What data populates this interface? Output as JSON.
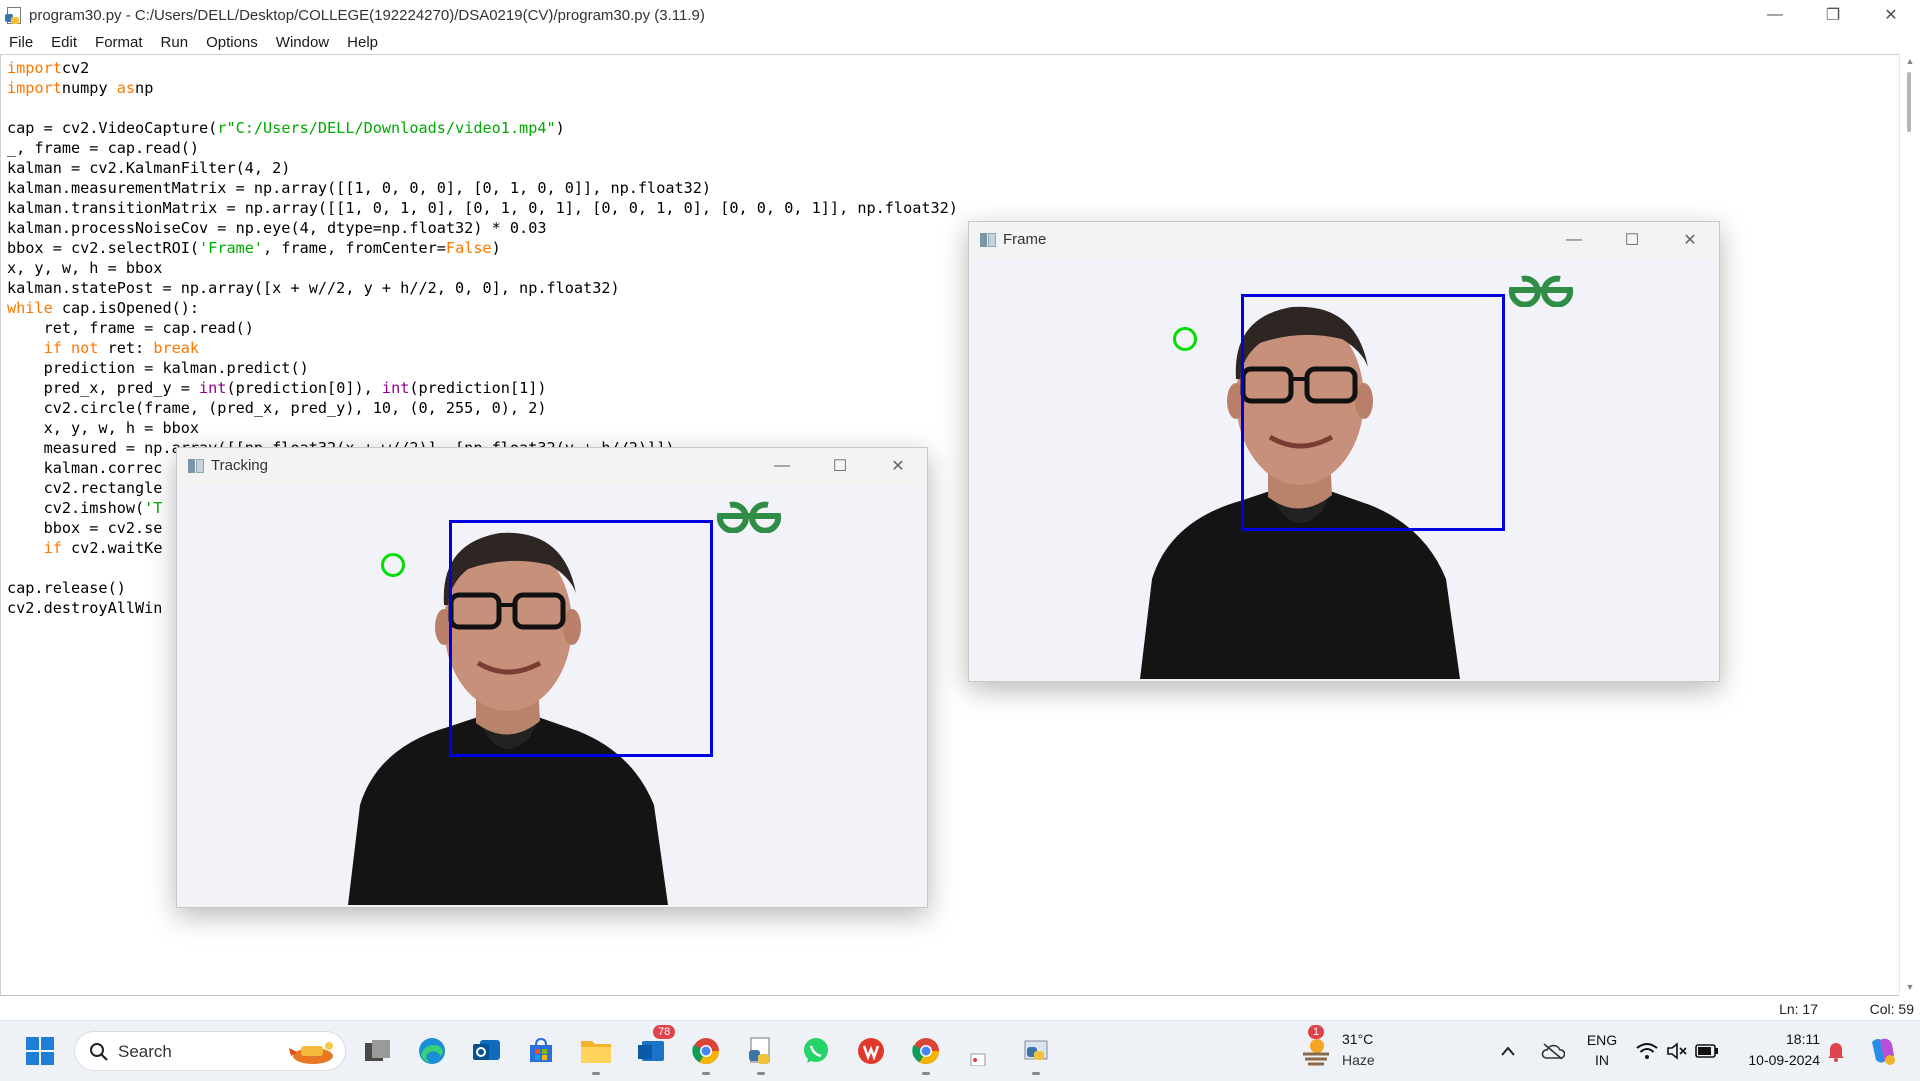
{
  "window": {
    "title": "program30.py - C:/Users/DELL/Desktop/COLLEGE(192224270)/DSA0219(CV)/program30.py (3.11.9)",
    "minimize_glyph": "—",
    "restore_glyph": "❐",
    "close_glyph": "✕"
  },
  "menu": [
    "File",
    "Edit",
    "Format",
    "Run",
    "Options",
    "Window",
    "Help"
  ],
  "code_lines": [
    [
      [
        "kw",
        "import"
      ],
      [
        "",
        "cv2"
      ]
    ],
    [
      [
        "kw",
        "import"
      ],
      [
        "",
        "numpy "
      ],
      [
        "kw",
        "as"
      ],
      [
        "",
        "np"
      ]
    ],
    [],
    [
      [
        "",
        "cap = cv2.VideoCapture("
      ],
      [
        "st",
        "r\"C:/Users/DELL/Downloads/video1.mp4\""
      ],
      [
        "",
        ")"
      ]
    ],
    [
      [
        "",
        "_, frame = cap.read()"
      ]
    ],
    [
      [
        "",
        "kalman = cv2.KalmanFilter(4, 2)"
      ]
    ],
    [
      [
        "",
        "kalman.measurementMatrix = np.array([[1, 0, 0, 0], [0, 1, 0, 0]], np.float32)"
      ]
    ],
    [
      [
        "",
        "kalman.transitionMatrix = np.array([[1, 0, 1, 0], [0, 1, 0, 1], [0, 0, 1, 0], [0, 0, 0, 1]], np.float32)"
      ]
    ],
    [
      [
        "",
        "kalman.processNoiseCov = np.eye(4, dtype=np.float32) * 0.03"
      ]
    ],
    [
      [
        "",
        "bbox = cv2.selectROI("
      ],
      [
        "st",
        "'Frame'"
      ],
      [
        "",
        ", frame, fromCenter="
      ],
      [
        "kw",
        "False"
      ],
      [
        "",
        ")"
      ]
    ],
    [
      [
        "",
        "x, y, w, h = bbox"
      ]
    ],
    [
      [
        "",
        "kalman.statePost = np.array([x + w//2, y + h//2, 0, 0], np.float32)"
      ]
    ],
    [
      [
        "kw",
        "while"
      ],
      [
        "",
        "",
        " "
      ],
      [
        "",
        "cap.isOpened():"
      ]
    ],
    [
      [
        "",
        "    ret, frame = cap.read()"
      ]
    ],
    [
      [
        "",
        "    "
      ],
      [
        "kw",
        "if not"
      ],
      [
        "",
        "",
        " "
      ],
      [
        "",
        "ret: "
      ],
      [
        "kw",
        "break"
      ]
    ],
    [
      [
        "",
        "    prediction = kalman.predict()"
      ]
    ],
    [
      [
        "",
        "    pred_x, pred_y = "
      ],
      [
        "bi",
        "int"
      ],
      [
        "",
        "(prediction[0]), "
      ],
      [
        "bi",
        "int"
      ],
      [
        "",
        "(prediction[1])"
      ]
    ],
    [
      [
        "",
        "    cv2.circle(frame, (pred_x, pred_y), 10, (0, 255, 0), 2)"
      ]
    ],
    [
      [
        "",
        "    x, y, w, h = bbox"
      ]
    ],
    [
      [
        "",
        "    measured = np.array([[np.float32(x + w//2)], [np.float32(y + h//2)]])"
      ]
    ],
    [
      [
        "",
        "    kalman.correc"
      ]
    ],
    [
      [
        "",
        "    cv2.rectangle"
      ]
    ],
    [
      [
        "",
        "    cv2.imshow("
      ],
      [
        "st",
        "'T"
      ]
    ],
    [
      [
        "",
        "    bbox = cv2.se"
      ]
    ],
    [
      [
        "",
        "    "
      ],
      [
        "kw",
        "if"
      ],
      [
        "",
        "",
        " "
      ],
      [
        "",
        "cv2.waitKe"
      ]
    ],
    [],
    [
      [
        "",
        "cap.release()"
      ]
    ],
    [
      [
        "",
        "cv2.destroyAllWin"
      ]
    ]
  ],
  "status": {
    "line": "Ln: 17",
    "col": "Col: 59"
  },
  "cv_windows": {
    "frame": {
      "title": "Frame"
    },
    "tracking": {
      "title": "Tracking"
    }
  },
  "taskbar": {
    "search_label": "Search",
    "outlook_badge": "78",
    "weather_badge": "1",
    "weather_temp": "31°C",
    "weather_desc": "Haze",
    "lang_top": "ENG",
    "lang_bottom": "IN",
    "time": "18:11",
    "date": "10-09-2024"
  }
}
